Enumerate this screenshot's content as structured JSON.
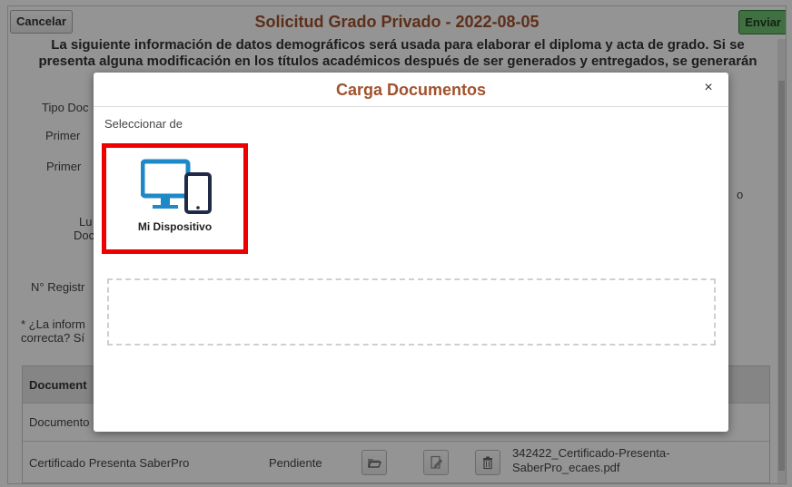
{
  "page": {
    "title": "Solicitud Grado Privado - 2022-08-05",
    "cancel_label": "Cancelar",
    "send_label": "Enviar",
    "intro_line1": "La siguiente información de datos demográficos será usada para elaborar el diploma y acta de grado. Si se",
    "intro_line2": "presenta alguna modificación en los títulos académicos después de ser generados y entregados, se generarán",
    "labels": {
      "tipo_doc": "Tipo Doc",
      "primer_1": "Primer",
      "primer_2": "Primer",
      "lu": "Lu",
      "doc": "Doc",
      "n_registro": "N° Registr",
      "informacion_line1": "* ¿La inform",
      "informacion_line2": "correcta? Sí",
      "right_o": "o"
    },
    "table": {
      "header": "Document",
      "row1": "Documento",
      "row2": {
        "name": "Certificado Presenta SaberPro",
        "status": "Pendiente",
        "file_line1": "342422_Certificado-Presenta-",
        "file_line2": "SaberPro_ecaes.pdf"
      }
    }
  },
  "modal": {
    "title": "Carga Documentos",
    "close_symbol": "×",
    "select_from_label": "Seleccionar de",
    "device_option_label": "Mi Dispositivo"
  },
  "colors": {
    "title": "#a0522d",
    "highlight": "#ee0000",
    "device_icon": "#1e88c8",
    "send_button": "#6fbf73"
  }
}
